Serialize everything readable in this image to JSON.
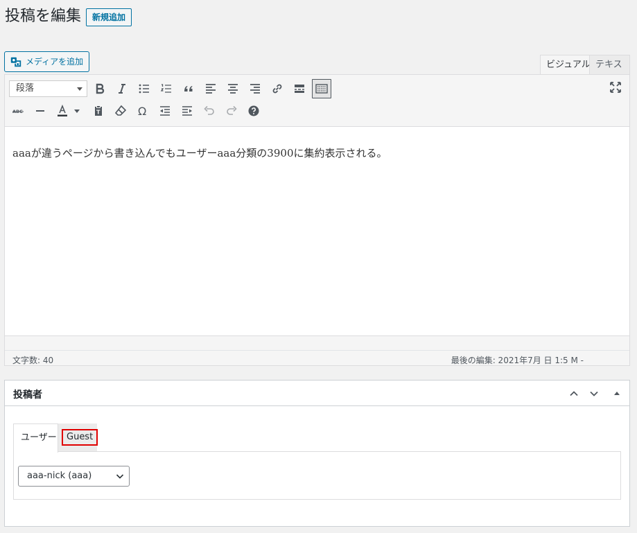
{
  "page": {
    "title": "投稿を編集",
    "add_new": "新規追加"
  },
  "editor": {
    "add_media": "メディアを追加",
    "tabs": {
      "visual": "ビジュアル",
      "text": "テキスト"
    },
    "format_select": "段落",
    "toolbar_row1": [
      "bold-icon",
      "italic-icon",
      "bullet-list-icon",
      "numbered-list-icon",
      "blockquote-icon",
      "align-left-icon",
      "align-center-icon",
      "align-right-icon",
      "link-icon",
      "read-more-icon",
      "toolbar-toggle-icon",
      "fullscreen-icon"
    ],
    "toolbar_row2": [
      "strikethrough-icon",
      "horizontal-line-icon",
      "text-color-icon",
      "paste-text-icon",
      "clear-formatting-icon",
      "special-character-icon",
      "outdent-icon",
      "indent-icon",
      "undo-icon",
      "redo-icon",
      "help-icon"
    ],
    "content": "aaaが違うページから書き込んでもユーザーaaa分類の3900に集約表示される。",
    "word_count": "文字数: 40",
    "last_edited": "最後の編集: 2021年7月  日 1:5     M -"
  },
  "author_box": {
    "title": "投稿者",
    "tabs": {
      "user": "ユーザー",
      "guest": "Guest"
    },
    "selected_user": "aaa-nick (aaa)"
  },
  "colors": {
    "accent": "#0071a1",
    "highlight_box": "#e00000",
    "background": "#f1f1f1"
  }
}
